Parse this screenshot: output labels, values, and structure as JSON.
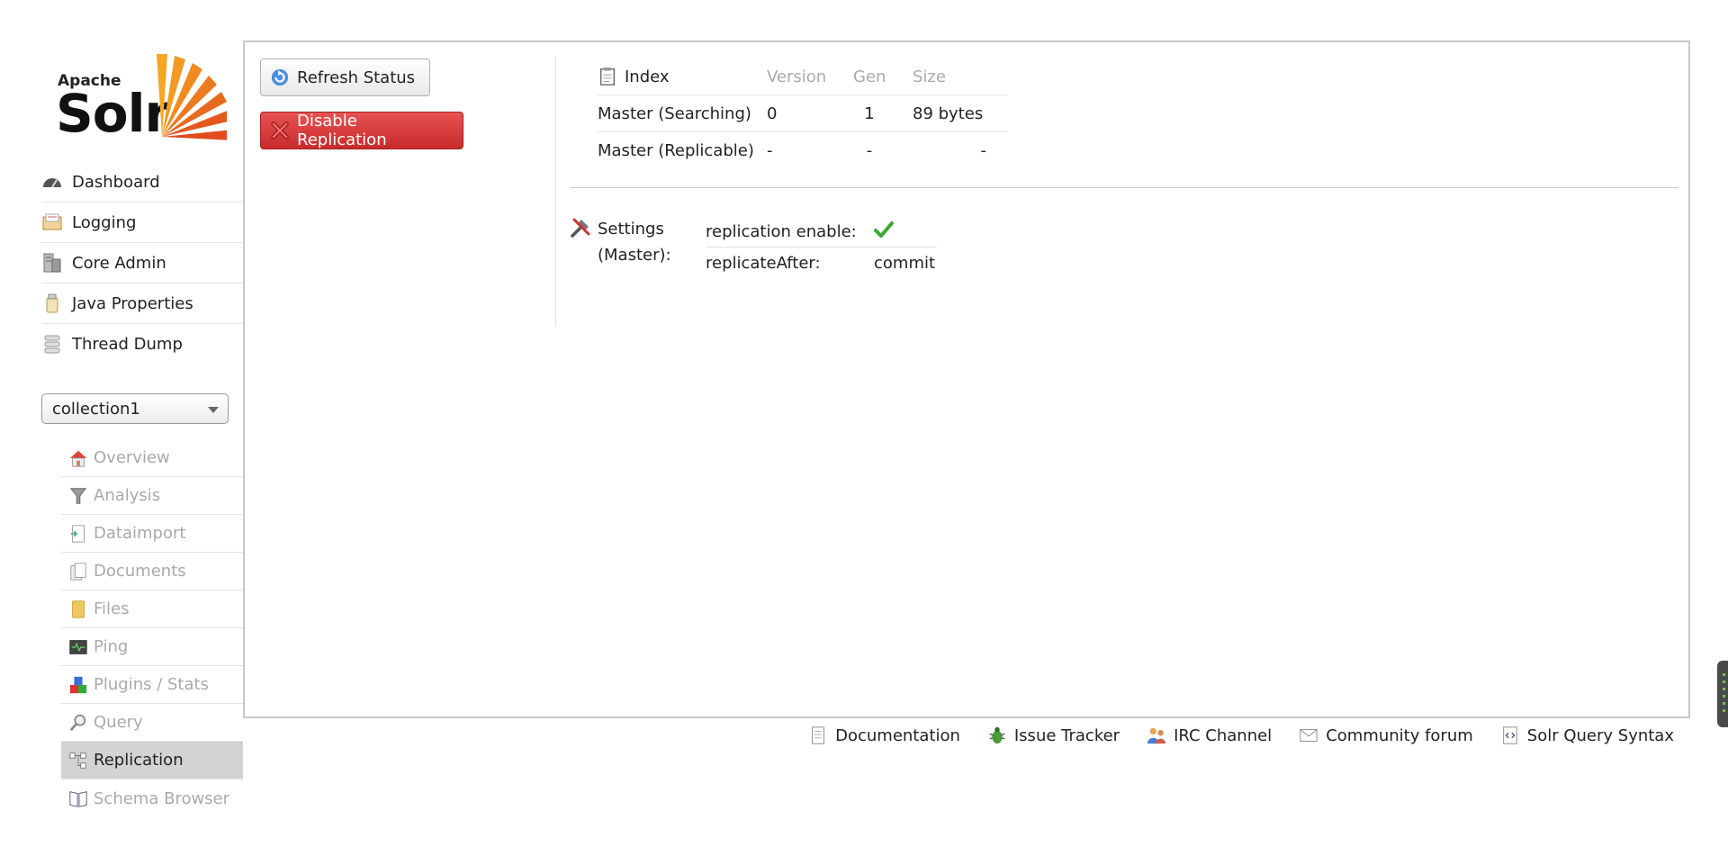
{
  "logo": {
    "small": "Apache",
    "large": "Solr"
  },
  "main_nav": [
    {
      "label": "Dashboard",
      "icon": "dashboard-icon"
    },
    {
      "label": "Logging",
      "icon": "logging-icon"
    },
    {
      "label": "Core Admin",
      "icon": "core-admin-icon"
    },
    {
      "label": "Java Properties",
      "icon": "java-properties-icon"
    },
    {
      "label": "Thread Dump",
      "icon": "thread-dump-icon"
    }
  ],
  "core_selector": {
    "value": "collection1"
  },
  "core_nav": [
    {
      "label": "Overview",
      "icon": "overview-icon",
      "active": false
    },
    {
      "label": "Analysis",
      "icon": "analysis-icon",
      "active": false
    },
    {
      "label": "Dataimport",
      "icon": "dataimport-icon",
      "active": false
    },
    {
      "label": "Documents",
      "icon": "documents-icon",
      "active": false
    },
    {
      "label": "Files",
      "icon": "files-icon",
      "active": false
    },
    {
      "label": "Ping",
      "icon": "ping-icon",
      "active": false
    },
    {
      "label": "Plugins / Stats",
      "icon": "plugins-icon",
      "active": false
    },
    {
      "label": "Query",
      "icon": "query-icon",
      "active": false
    },
    {
      "label": "Replication",
      "icon": "replication-icon",
      "active": true
    },
    {
      "label": "Schema Browser",
      "icon": "schema-browser-icon",
      "active": false
    }
  ],
  "buttons": {
    "refresh": "Refresh Status",
    "disable": "Disable Replication"
  },
  "index_table": {
    "headers": [
      "Index",
      "Version",
      "Gen",
      "Size"
    ],
    "rows": [
      [
        "Master (Searching)",
        "0",
        "1",
        "89 bytes"
      ],
      [
        "Master (Replicable)",
        "-",
        "-",
        "-"
      ]
    ]
  },
  "settings": {
    "label_line1": "Settings",
    "label_line2": "(Master):",
    "rows": [
      {
        "key": "replication enable:",
        "value": "",
        "value_icon": "check-icon"
      },
      {
        "key": "replicateAfter:",
        "value": "commit"
      }
    ]
  },
  "footer": [
    {
      "label": "Documentation",
      "icon": "documentation-icon"
    },
    {
      "label": "Issue Tracker",
      "icon": "bug-icon"
    },
    {
      "label": "IRC Channel",
      "icon": "irc-icon"
    },
    {
      "label": "Community forum",
      "icon": "mail-icon"
    },
    {
      "label": "Solr Query Syntax",
      "icon": "query-syntax-icon"
    }
  ],
  "colors": {
    "disable_button": "#d33b3b",
    "active_nav_bg": "#d3d3d3",
    "check": "#3aa832"
  }
}
